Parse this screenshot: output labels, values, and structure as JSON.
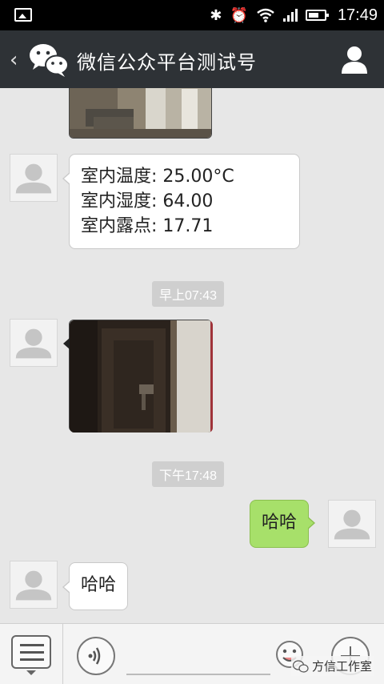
{
  "status_bar": {
    "time": "17:49",
    "icons": [
      "image-icon",
      "bluetooth-icon",
      "alarm-icon",
      "wifi-icon",
      "signal-icon",
      "battery-icon"
    ]
  },
  "header": {
    "back_glyph": "‹",
    "title": "微信公众平台测试号",
    "icons": [
      "back-icon",
      "wechat-logo-icon",
      "profile-icon"
    ],
    "bar_color": "#2e3236"
  },
  "messages": [
    {
      "type": "image",
      "side": "left",
      "description_icon": "room-photo"
    },
    {
      "type": "text",
      "side": "left",
      "lines": [
        "室内温度: 25.00°C",
        "室内湿度: 64.00",
        "室内露点: 17.71"
      ]
    },
    {
      "type": "time",
      "label": "早上07:43"
    },
    {
      "type": "image",
      "side": "left",
      "description_icon": "door-photo"
    },
    {
      "type": "time",
      "label": "下午17:48"
    },
    {
      "type": "text",
      "side": "right",
      "lines": [
        "哈哈"
      ]
    },
    {
      "type": "text",
      "side": "left",
      "lines": [
        "哈哈"
      ]
    }
  ],
  "input_bar": {
    "text_value": "",
    "icons": [
      "menu-icon",
      "voice-icon",
      "emoji-icon",
      "plus-icon"
    ],
    "watermark": "方信工作室"
  },
  "colors": {
    "sent_bubble": "#a7e06a",
    "received_bubble": "#ffffff",
    "chat_background": "#e7e7e7"
  }
}
